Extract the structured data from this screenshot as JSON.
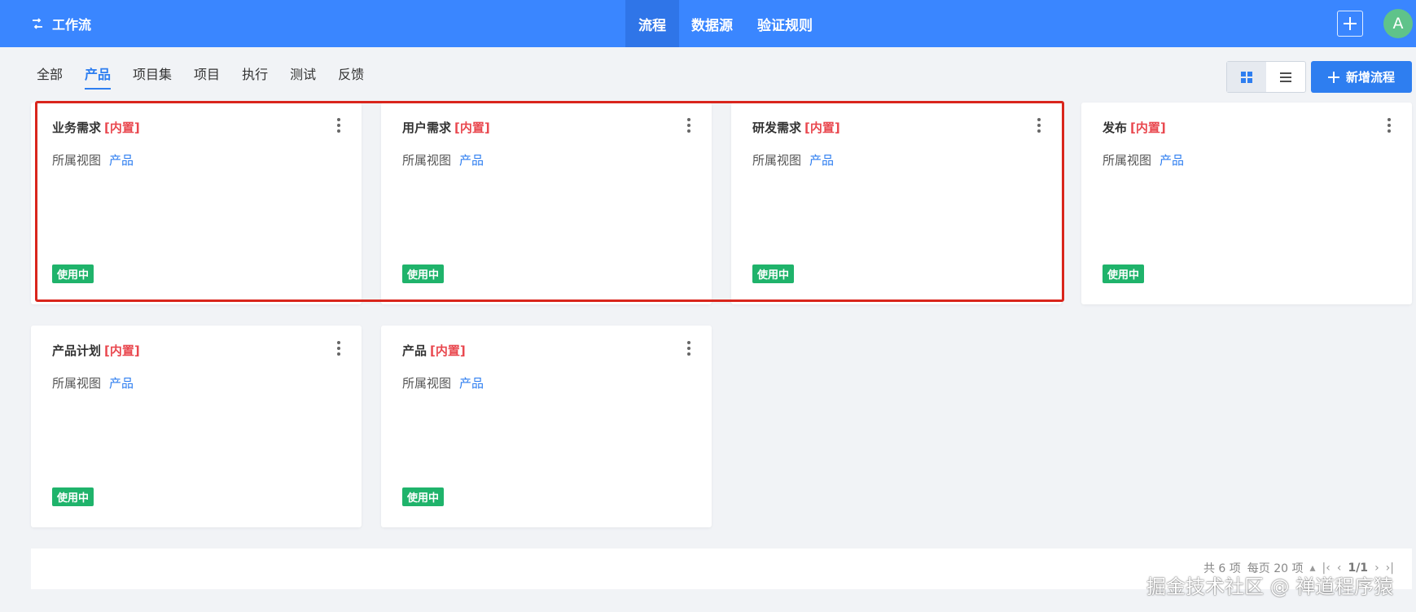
{
  "app": {
    "title": "工作流"
  },
  "topnav": {
    "items": [
      {
        "label": "流程"
      },
      {
        "label": "数据源"
      },
      {
        "label": "验证规则"
      }
    ]
  },
  "user": {
    "avatar_letter": "A"
  },
  "subtabs": [
    {
      "label": "全部"
    },
    {
      "label": "产品"
    },
    {
      "label": "项目集"
    },
    {
      "label": "项目"
    },
    {
      "label": "执行"
    },
    {
      "label": "测试"
    },
    {
      "label": "反馈"
    }
  ],
  "toolbar": {
    "new_label": "新增流程"
  },
  "cards": [
    {
      "title": "业务需求",
      "tag": "[内置]",
      "view_label": "所属视图",
      "view_value": "产品",
      "status": "使用中"
    },
    {
      "title": "用户需求",
      "tag": "[内置]",
      "view_label": "所属视图",
      "view_value": "产品",
      "status": "使用中"
    },
    {
      "title": "研发需求",
      "tag": "[内置]",
      "view_label": "所属视图",
      "view_value": "产品",
      "status": "使用中"
    },
    {
      "title": "发布",
      "tag": "[内置]",
      "view_label": "所属视图",
      "view_value": "产品",
      "status": "使用中"
    },
    {
      "title": "产品计划",
      "tag": "[内置]",
      "view_label": "所属视图",
      "view_value": "产品",
      "status": "使用中"
    },
    {
      "title": "产品",
      "tag": "[内置]",
      "view_label": "所属视图",
      "view_value": "产品",
      "status": "使用中"
    }
  ],
  "pager": {
    "total_text": "共 6 项",
    "per_page_text": "每页 20 项",
    "page_text": "1/1"
  },
  "watermark": "掘金技术社区 @ 禅道程序猿",
  "colors": {
    "topbar": "#3a86ff",
    "accent": "#2e7ef0",
    "tag": "#e9484f",
    "status": "#1fb36b",
    "highlight": "#d9251c"
  }
}
